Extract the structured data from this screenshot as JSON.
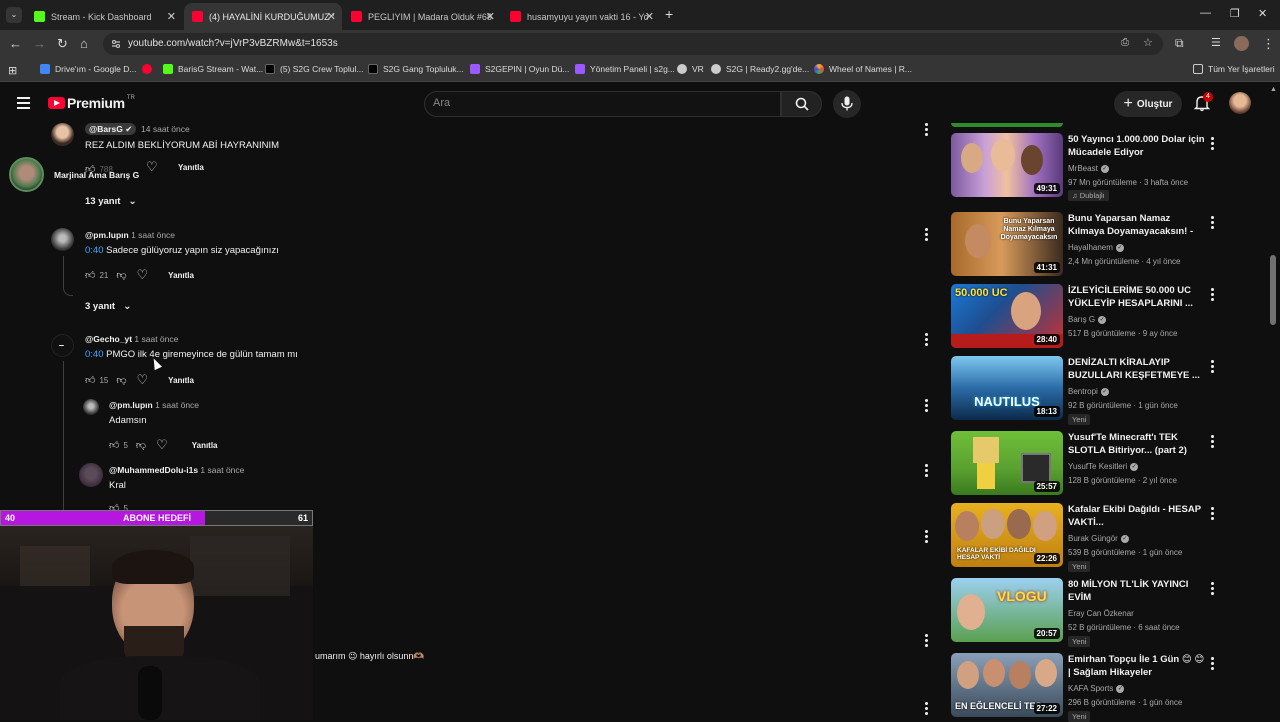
{
  "browser": {
    "tabs": [
      {
        "title": "Stream - Kick Dashboard",
        "active": false,
        "favicon": "kick-icon",
        "color": "#53fc18"
      },
      {
        "title": "(4) HAYALİNİ KURDUĞUMUZ Y",
        "active": true,
        "favicon": "youtube-icon",
        "color": "#ff0033"
      },
      {
        "title": "PEGLIYIM | Madara Olduk #68",
        "active": false,
        "favicon": "youtube-icon",
        "color": "#ff0033"
      },
      {
        "title": "husamyuyu yayın vakti 16 - Yo",
        "active": false,
        "favicon": "youtube-icon",
        "color": "#ff0033"
      }
    ],
    "url": "youtube.com/watch?v=jVrP3vBZRMw&t=1653s",
    "bookmarks": [
      {
        "label": "Drive'ım - Google D...",
        "color": "#4285f4"
      },
      {
        "label": "",
        "color": "#ff0033"
      },
      {
        "label": "BarisG Stream - Wat...",
        "color": "#53fc18"
      },
      {
        "label": "(5) S2G Crew Toplul...",
        "color": "#000000"
      },
      {
        "label": "S2G Gang Topluluk...",
        "color": "#000000"
      },
      {
        "label": "S2GEPIN | Oyun Dü...",
        "color": "#9b59ff"
      },
      {
        "label": "Yönetim Paneli | s2g...",
        "color": "#9b59ff"
      },
      {
        "label": "VR",
        "color": "#cccccc"
      },
      {
        "label": "S2G | Ready2.gg'de...",
        "color": "#cccccc"
      },
      {
        "label": "Wheel of Names | R...",
        "color": "#f2b632"
      }
    ],
    "all_bookmarks": "Tüm Yer İşaretleri"
  },
  "header": {
    "logo_text": "Premium",
    "country": "TR",
    "search_placeholder": "Ara",
    "create_label": "Oluştur",
    "notifications": "4"
  },
  "comments": [
    {
      "handle": "@BarsG",
      "time": "14 saat önce",
      "text": "REZ ALDIM BEKLİYORUM ABİ HAYRANINIM",
      "likes": "788",
      "reply": "Yanıtla",
      "pinned_by": "Marjinal Ama Barış G",
      "replies_toggle": "13 yanıt"
    },
    {
      "handle": "@pm.lupın",
      "time": "1 saat önce",
      "timestamp": "0:40",
      "text": "Sadece gülüyoruz yapın siz yapacağınızı",
      "likes": "21",
      "reply": "Yanıtla",
      "replies_toggle": "3 yanıt"
    },
    {
      "handle": "@Gecho_yt",
      "time": "1 saat önce",
      "timestamp": "0:40",
      "text": "PMGO ilk 4e giremeyince de gülün tamam mı",
      "likes": "15",
      "reply": "Yanıtla"
    },
    {
      "handle": "@pm.lupın",
      "time": "1 saat önce",
      "text": "Adamsın",
      "likes": "5",
      "reply": "Yanıtla"
    },
    {
      "handle": "@MuhammedDolu-i1s",
      "time": "1 saat önce",
      "text": "Kral",
      "likes": "5",
      "reply": "Yanıtla"
    }
  ],
  "partial_comment": "umarım 😉 hayırlı olsunn🫶🏽",
  "sidebar_videos": [
    {
      "title": "50 Yayıncı 1.000.000 Dolar için Mücadele Ediyor",
      "channel": "MrBeast",
      "stats": "97 Mn görüntüleme · 3 hafta önce",
      "badge": "Dublajlı",
      "duration": "49:31"
    },
    {
      "title": "Bunu Yaparsan Namaz Kılmaya Doyamayacaksın! - Şikemperv...",
      "channel": "Hayalhanem",
      "stats": "2,4 Mn görüntüleme · 4 yıl önce",
      "badge": "",
      "duration": "41:31",
      "thumb_text": "Bunu Yaparsan Namaz Kılmaya Doyamayacaksın"
    },
    {
      "title": "İZLEYİCİLERİME 50.000 UC YÜKLEYİP HESAPLARINI ...",
      "channel": "Barış G",
      "stats": "517 B görüntüleme · 9 ay önce",
      "badge": "",
      "duration": "28:40",
      "thumb_text": "50.000 UC"
    },
    {
      "title": "DENİZALTI KİRALAYIP BUZULLARI KEŞFETMEYE ...",
      "channel": "Bentropi",
      "stats": "92 B görüntüleme · 1 gün önce",
      "badge": "Yeni",
      "duration": "18:13",
      "thumb_text": "NAUTILUS"
    },
    {
      "title": "Yusuf'Te Minecraft'ı TEK SLOTLA Bitiriyor... (part 2)",
      "channel": "YusufTe Kesitleri",
      "stats": "128 B görüntüleme · 2 yıl önce",
      "badge": "",
      "duration": "25:57"
    },
    {
      "title": "Kafalar Ekibi Dağıldı - HESAP VAKTİ...",
      "channel": "Burak Güngör",
      "stats": "539 B görüntüleme · 1 gün önce",
      "badge": "Yeni",
      "duration": "22:26",
      "thumb_text": "KAFALAR EKİBİ DAĞILDI HESAP VAKTİ"
    },
    {
      "title": "80 MİLYON TL'LİK YAYINCI EVİM",
      "channel": "Eray Can Özkenar",
      "stats": "52 B görüntüleme · 6 saat önce",
      "badge": "Yeni",
      "duration": "20:57",
      "thumb_text": "VLOGU"
    },
    {
      "title": "Emirhan Topçu İle 1 Gün 😊 😊 | Sağlam Hikayeler",
      "channel": "KAFA Sports",
      "stats": "296 B görüntüleme · 1 gün önce",
      "badge": "Yeni",
      "duration": "27:22",
      "thumb_text": "EN EĞLENCELİ TES"
    }
  ],
  "overlay": {
    "goal_label": "ABONE HEDEFİ",
    "goal_current": "40",
    "goal_target": "61",
    "progress": 0.656
  }
}
